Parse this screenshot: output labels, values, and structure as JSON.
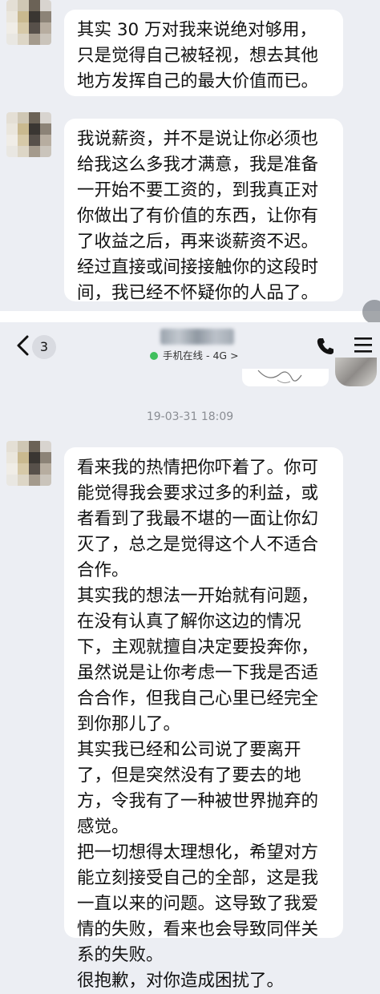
{
  "messages_top": [
    {
      "sender": "contact",
      "text": "其实 30 万对我来说绝对够用，\n只是觉得自己被轻视，想去其他\n地方发挥自己的最大价值而已。"
    },
    {
      "sender": "contact",
      "text": "我说薪资，并不是说让你必须也\n给我这么多我才满意，我是准备\n一开始不要工资的，到我真正对\n你做出了有价值的东西，让你有\n了收益之后，再来谈薪资不迟。\n经过直接或间接接触你的这段时\n间，我已经不怀疑你的人品了。"
    }
  ],
  "nav": {
    "unread_count": "3",
    "online_status": "手机在线 - 4G >",
    "icons": [
      "back-chevron-icon",
      "phone-icon",
      "menu-icon"
    ]
  },
  "timestamp": "19-03-31 18:09",
  "messages_bottom": [
    {
      "sender": "contact",
      "text": "看来我的热情把你吓着了。你可\n能觉得我会要求过多的利益，或\n者看到了我最不堪的一面让你幻\n灭了，总之是觉得这个人不适合\n合作。\n其实我的想法一开始就有问题，\n在没有认真了解你这边的情况\n下，主观就擅自决定要投奔你，\n虽然说是让你考虑一下我是否适\n合合作，但我自己心里已经完全\n到你那儿了。\n其实我已经和公司说了要离开\n了，但是突然没有了要去的地\n方，令我有了一种被世界抛弃的\n感觉。\n把一切想得太理想化，希望对方\n能立刻接受自己的全部，这是我\n一直以来的问题。这导致了我爱\n情的失败，看来也会导致同伴关\n系的失败。\n很抱歉，对你造成困扰了。"
    }
  ],
  "colors": {
    "chat_background": "#eceef3",
    "bubble": "#ffffff",
    "text": "#111111",
    "timestamp": "#8a8d93",
    "online_dot": "#3fbf5d"
  }
}
